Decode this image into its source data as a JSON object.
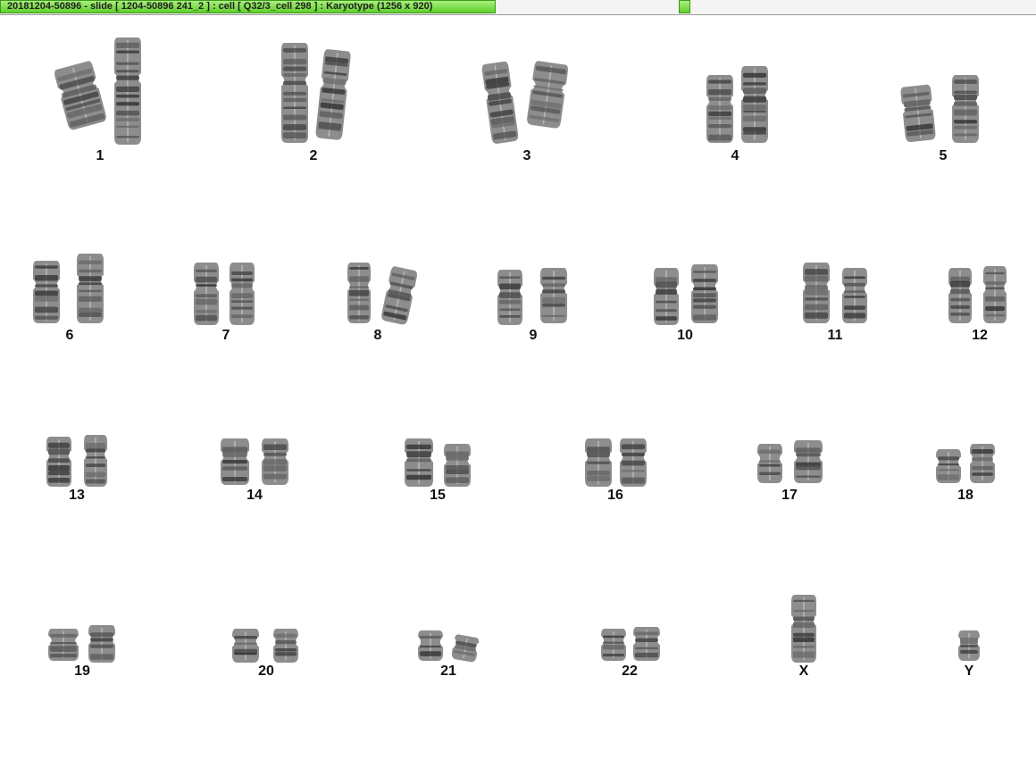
{
  "window": {
    "title": "20181204-50896 - slide [ 1204-50896 241_2 ] : cell [ Q32/3_cell 298 ] : Karyotype  (1256 x 920)"
  },
  "karyotype": {
    "labels": [
      "1",
      "2",
      "3",
      "4",
      "5",
      "6",
      "7",
      "8",
      "9",
      "10",
      "11",
      "12",
      "13",
      "14",
      "15",
      "16",
      "17",
      "18",
      "19",
      "20",
      "21",
      "22",
      "X",
      "Y"
    ]
  }
}
